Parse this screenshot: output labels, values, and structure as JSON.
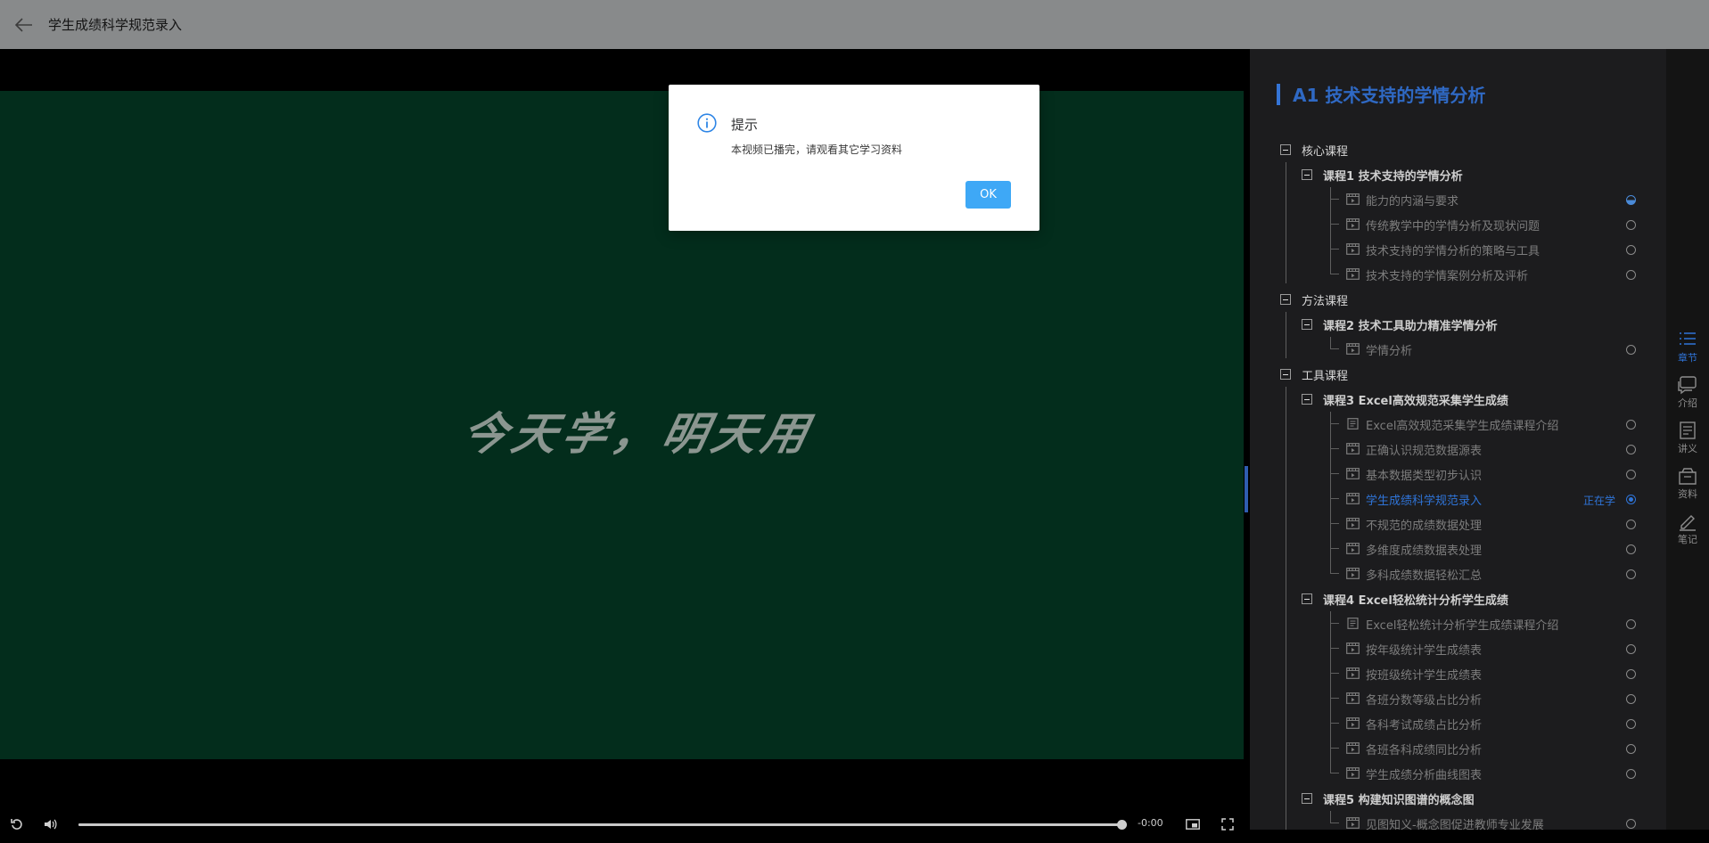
{
  "header": {
    "title": "学生成绩科学规范录入",
    "back_icon": "arrow-left-icon"
  },
  "video": {
    "watermark": "今天学，明天用",
    "time": "-0:00",
    "progress": 1.0,
    "background_color": "#032d1c"
  },
  "dialog": {
    "title": "提示",
    "message": "本视频已播完，请观看其它学习资料",
    "ok_label": "OK",
    "icon": "info-icon"
  },
  "panel": {
    "title": "A1 技术支持的学情分析",
    "learning_label": "正在学",
    "accent": "#2f74d8",
    "groups": [
      {
        "label": "核心课程",
        "courses": [
          {
            "label": "课程1 技术支持的学情分析",
            "lessons": [
              {
                "label": "能力的内涵与要求",
                "type": "video",
                "status": "half"
              },
              {
                "label": "传统教学中的学情分析及现状问题",
                "type": "video",
                "status": "none"
              },
              {
                "label": "技术支持的学情分析的策略与工具",
                "type": "video",
                "status": "none"
              },
              {
                "label": "技术支持的学情案例分析及评析",
                "type": "video",
                "status": "none"
              }
            ]
          }
        ]
      },
      {
        "label": "方法课程",
        "courses": [
          {
            "label": "课程2 技术工具助力精准学情分析",
            "lessons": [
              {
                "label": "学情分析",
                "type": "video",
                "status": "none"
              }
            ]
          }
        ]
      },
      {
        "label": "工具课程",
        "courses": [
          {
            "label": "课程3 Excel高效规范采集学生成绩",
            "lessons": [
              {
                "label": "Excel高效规范采集学生成绩课程介绍",
                "type": "doc",
                "status": "none"
              },
              {
                "label": "正确认识规范数据源表",
                "type": "video",
                "status": "none"
              },
              {
                "label": "基本数据类型初步认识",
                "type": "video",
                "status": "none"
              },
              {
                "label": "学生成绩科学规范录入",
                "type": "video",
                "status": "current"
              },
              {
                "label": "不规范的成绩数据处理",
                "type": "video",
                "status": "none"
              },
              {
                "label": "多维度成绩数据表处理",
                "type": "video",
                "status": "none"
              },
              {
                "label": "多科成绩数据轻松汇总",
                "type": "video",
                "status": "none"
              }
            ]
          },
          {
            "label": "课程4 Excel轻松统计分析学生成绩",
            "lessons": [
              {
                "label": "Excel轻松统计分析学生成绩课程介绍",
                "type": "doc",
                "status": "none"
              },
              {
                "label": "按年级统计学生成绩表",
                "type": "video",
                "status": "none"
              },
              {
                "label": "按班级统计学生成绩表",
                "type": "video",
                "status": "none"
              },
              {
                "label": "各班分数等级占比分析",
                "type": "video",
                "status": "none"
              },
              {
                "label": "各科考试成绩占比分析",
                "type": "video",
                "status": "none"
              },
              {
                "label": "各班各科成绩同比分析",
                "type": "video",
                "status": "none"
              },
              {
                "label": "学生成绩分析曲线图表",
                "type": "video",
                "status": "none"
              }
            ]
          },
          {
            "label": "课程5 构建知识图谱的概念图",
            "lessons": [
              {
                "label": "见图知义-概念图促进教师专业发展",
                "type": "video",
                "status": "none"
              }
            ]
          }
        ]
      }
    ]
  },
  "tabs": [
    {
      "label": "章节",
      "icon": "list-icon",
      "active": true
    },
    {
      "label": "介绍",
      "icon": "chat-icon",
      "active": false
    },
    {
      "label": "讲义",
      "icon": "document-icon",
      "active": false
    },
    {
      "label": "资料",
      "icon": "folder-icon",
      "active": false
    },
    {
      "label": "笔记",
      "icon": "pen-icon",
      "active": false
    }
  ]
}
